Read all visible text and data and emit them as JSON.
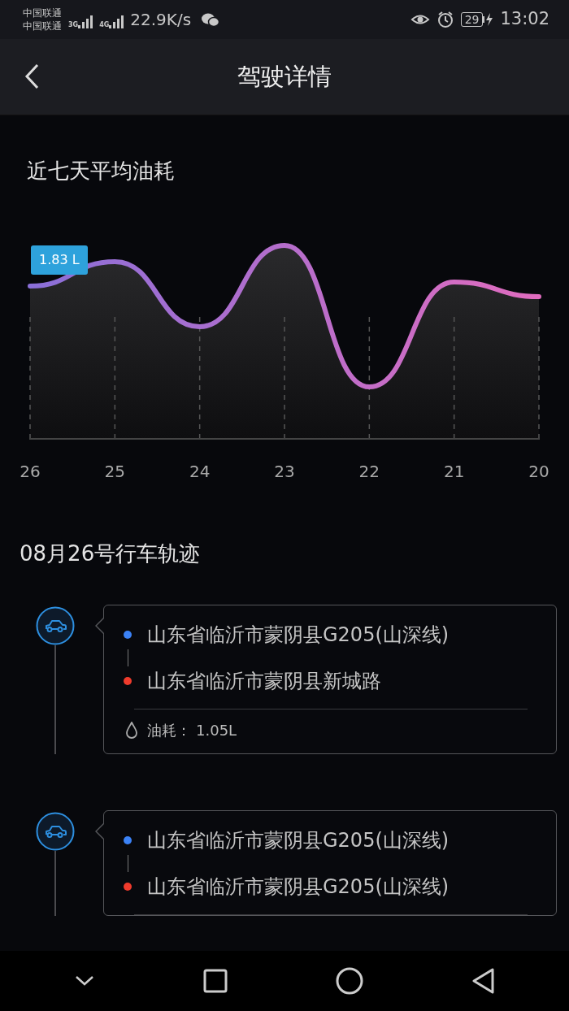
{
  "status_bar": {
    "carriers": [
      "中国联通",
      "中国联通"
    ],
    "networks": [
      "3G",
      "4G"
    ],
    "speed": "22.9K/s",
    "battery": "29",
    "time": "13:02"
  },
  "header": {
    "title": "驾驶详情"
  },
  "chart": {
    "title": "近七天平均油耗",
    "tooltip": "1.83 L",
    "x_labels": [
      "26",
      "25",
      "24",
      "23",
      "22",
      "21",
      "20"
    ]
  },
  "trips_title": "08月26号行车轨迹",
  "trips": [
    {
      "start": "山东省临沂市蒙阴县G205(山深线)",
      "end": "山东省临沂市蒙阴县新城路",
      "fuel_label": "油耗：",
      "fuel": "1.05L"
    },
    {
      "start": "山东省临沂市蒙阴县G205(山深线)",
      "end": "山东省临沂市蒙阴县G205(山深线)"
    }
  ]
}
